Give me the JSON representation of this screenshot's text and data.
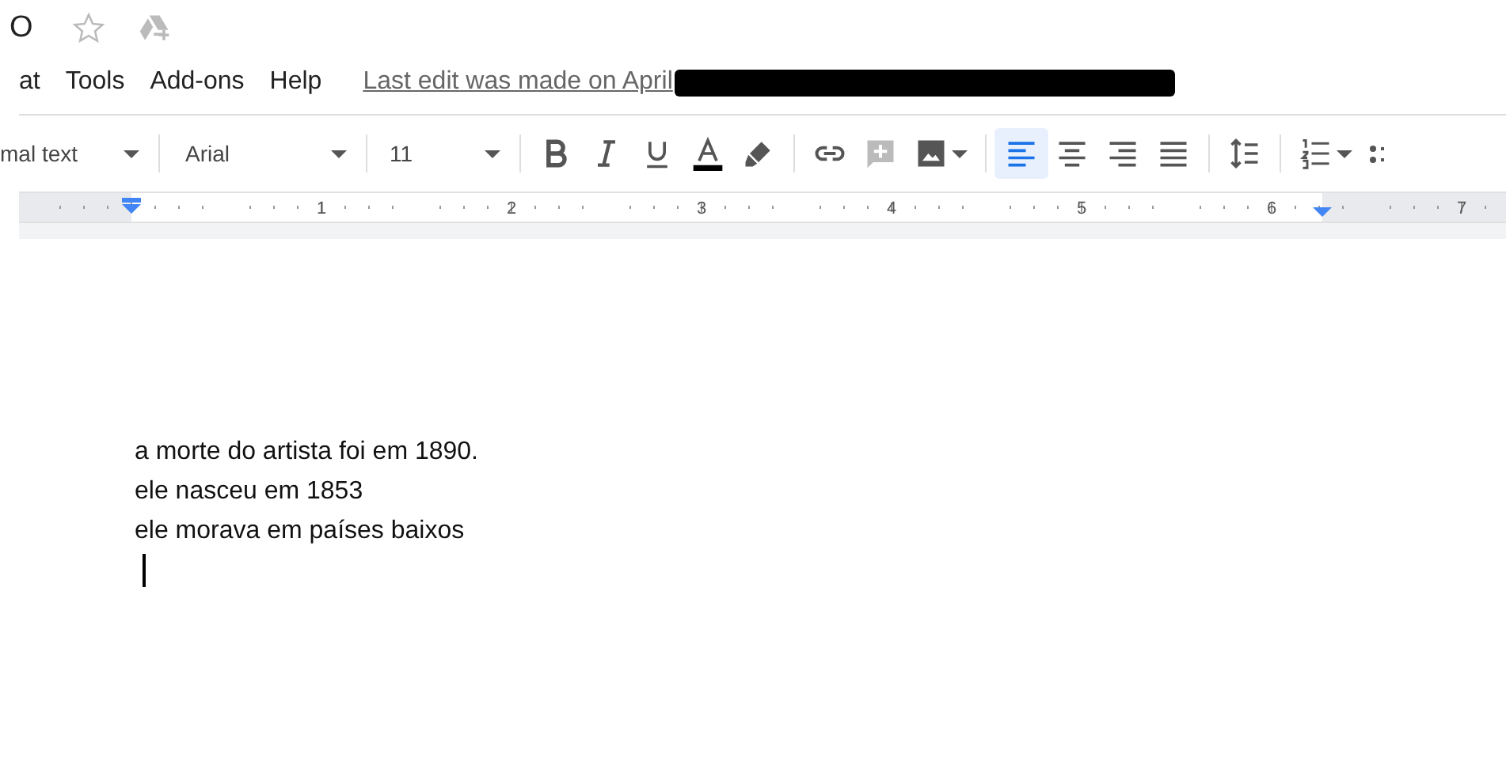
{
  "title": "O",
  "menu": [
    {
      "label": "at"
    },
    {
      "label": "Tools"
    },
    {
      "label": "Add-ons"
    },
    {
      "label": "Help"
    }
  ],
  "last_edit": "Last edit was made on April",
  "toolbar": [
    {
      "kind": "dropdown",
      "label": "mal text"
    },
    {
      "kind": "separator"
    },
    {
      "kind": "dropdown",
      "label": "Arial"
    },
    {
      "kind": "separator"
    },
    {
      "kind": "dropdown",
      "label": "11"
    },
    {
      "kind": "separator"
    },
    {
      "kind": "button",
      "selected": false
    },
    {
      "kind": "button",
      "selected": false
    },
    {
      "kind": "button",
      "selected": false
    },
    {
      "kind": "button",
      "selected": false
    },
    {
      "kind": "button",
      "selected": false
    },
    {
      "kind": "separator"
    },
    {
      "kind": "button",
      "selected": false
    },
    {
      "kind": "button",
      "selected": false,
      "disabled": true
    },
    {
      "kind": "button",
      "selected": false
    },
    {
      "kind": "separator"
    },
    {
      "kind": "button",
      "selected": true
    },
    {
      "kind": "button",
      "selected": false
    },
    {
      "kind": "button",
      "selected": false
    },
    {
      "kind": "button",
      "selected": false
    },
    {
      "kind": "separator"
    },
    {
      "kind": "button",
      "selected": false
    },
    {
      "kind": "separator"
    },
    {
      "kind": "button",
      "selected": false
    },
    {
      "kind": "button",
      "selected": false
    }
  ],
  "ruler": [
    "1",
    "2",
    "3",
    "4",
    "5",
    "6",
    "7"
  ],
  "document": {
    "lines": [
      "a morte do artista foi em 1890.",
      "ele nasceu em 1853",
      "ele morava em países baixos"
    ]
  }
}
